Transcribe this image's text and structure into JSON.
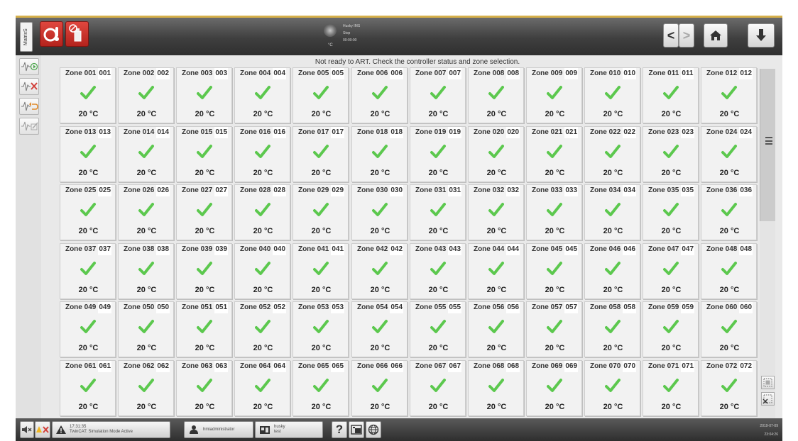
{
  "header": {
    "side_tab_label": "MatrixS",
    "media": {
      "unit": "°C",
      "line1": "Husky IMS",
      "line2": "Stop",
      "line3": "00:00:00"
    },
    "nav": {
      "back_label": "<",
      "forward_label": ">"
    }
  },
  "message": "Not ready to ART. Check the controller status and zone selection.",
  "zones": [
    {
      "name": "Zone 001",
      "num": "001",
      "temp": "20 °C",
      "status": "ok"
    },
    {
      "name": "Zone 002",
      "num": "002",
      "temp": "20 °C",
      "status": "ok"
    },
    {
      "name": "Zone 003",
      "num": "003",
      "temp": "20 °C",
      "status": "ok"
    },
    {
      "name": "Zone 004",
      "num": "004",
      "temp": "20 °C",
      "status": "ok"
    },
    {
      "name": "Zone 005",
      "num": "005",
      "temp": "20 °C",
      "status": "ok"
    },
    {
      "name": "Zone 006",
      "num": "006",
      "temp": "20 °C",
      "status": "ok"
    },
    {
      "name": "Zone 007",
      "num": "007",
      "temp": "20 °C",
      "status": "ok"
    },
    {
      "name": "Zone 008",
      "num": "008",
      "temp": "20 °C",
      "status": "ok"
    },
    {
      "name": "Zone 009",
      "num": "009",
      "temp": "20 °C",
      "status": "ok"
    },
    {
      "name": "Zone 010",
      "num": "010",
      "temp": "20 °C",
      "status": "ok"
    },
    {
      "name": "Zone 011",
      "num": "011",
      "temp": "20 °C",
      "status": "ok"
    },
    {
      "name": "Zone 012",
      "num": "012",
      "temp": "20 °C",
      "status": "ok"
    },
    {
      "name": "Zone 013",
      "num": "013",
      "temp": "20 °C",
      "status": "ok"
    },
    {
      "name": "Zone 014",
      "num": "014",
      "temp": "20 °C",
      "status": "ok"
    },
    {
      "name": "Zone 015",
      "num": "015",
      "temp": "20 °C",
      "status": "ok"
    },
    {
      "name": "Zone 016",
      "num": "016",
      "temp": "20 °C",
      "status": "ok"
    },
    {
      "name": "Zone 017",
      "num": "017",
      "temp": "20 °C",
      "status": "ok"
    },
    {
      "name": "Zone 018",
      "num": "018",
      "temp": "20 °C",
      "status": "ok"
    },
    {
      "name": "Zone 019",
      "num": "019",
      "temp": "20 °C",
      "status": "ok"
    },
    {
      "name": "Zone 020",
      "num": "020",
      "temp": "20 °C",
      "status": "ok"
    },
    {
      "name": "Zone 021",
      "num": "021",
      "temp": "20 °C",
      "status": "ok"
    },
    {
      "name": "Zone 022",
      "num": "022",
      "temp": "20 °C",
      "status": "ok"
    },
    {
      "name": "Zone 023",
      "num": "023",
      "temp": "20 °C",
      "status": "ok"
    },
    {
      "name": "Zone 024",
      "num": "024",
      "temp": "20 °C",
      "status": "ok"
    },
    {
      "name": "Zone 025",
      "num": "025",
      "temp": "20 °C",
      "status": "ok"
    },
    {
      "name": "Zone 026",
      "num": "026",
      "temp": "20 °C",
      "status": "ok"
    },
    {
      "name": "Zone 027",
      "num": "027",
      "temp": "20 °C",
      "status": "ok"
    },
    {
      "name": "Zone 028",
      "num": "028",
      "temp": "20 °C",
      "status": "ok"
    },
    {
      "name": "Zone 029",
      "num": "029",
      "temp": "20 °C",
      "status": "ok"
    },
    {
      "name": "Zone 030",
      "num": "030",
      "temp": "20 °C",
      "status": "ok"
    },
    {
      "name": "Zone 031",
      "num": "031",
      "temp": "20 °C",
      "status": "ok"
    },
    {
      "name": "Zone 032",
      "num": "032",
      "temp": "20 °C",
      "status": "ok"
    },
    {
      "name": "Zone 033",
      "num": "033",
      "temp": "20 °C",
      "status": "ok"
    },
    {
      "name": "Zone 034",
      "num": "034",
      "temp": "20 °C",
      "status": "ok"
    },
    {
      "name": "Zone 035",
      "num": "035",
      "temp": "20 °C",
      "status": "ok"
    },
    {
      "name": "Zone 036",
      "num": "036",
      "temp": "20 °C",
      "status": "ok"
    },
    {
      "name": "Zone 037",
      "num": "037",
      "temp": "20 °C",
      "status": "ok"
    },
    {
      "name": "Zone 038",
      "num": "038",
      "temp": "20 °C",
      "status": "ok"
    },
    {
      "name": "Zone 039",
      "num": "039",
      "temp": "20 °C",
      "status": "ok"
    },
    {
      "name": "Zone 040",
      "num": "040",
      "temp": "20 °C",
      "status": "ok"
    },
    {
      "name": "Zone 041",
      "num": "041",
      "temp": "20 °C",
      "status": "ok"
    },
    {
      "name": "Zone 042",
      "num": "042",
      "temp": "20 °C",
      "status": "ok"
    },
    {
      "name": "Zone 043",
      "num": "043",
      "temp": "20 °C",
      "status": "ok"
    },
    {
      "name": "Zone 044",
      "num": "044",
      "temp": "20 °C",
      "status": "ok"
    },
    {
      "name": "Zone 045",
      "num": "045",
      "temp": "20 °C",
      "status": "ok"
    },
    {
      "name": "Zone 046",
      "num": "046",
      "temp": "20 °C",
      "status": "ok"
    },
    {
      "name": "Zone 047",
      "num": "047",
      "temp": "20 °C",
      "status": "ok"
    },
    {
      "name": "Zone 048",
      "num": "048",
      "temp": "20 °C",
      "status": "ok"
    },
    {
      "name": "Zone 049",
      "num": "049",
      "temp": "20 °C",
      "status": "ok"
    },
    {
      "name": "Zone 050",
      "num": "050",
      "temp": "20 °C",
      "status": "ok"
    },
    {
      "name": "Zone 051",
      "num": "051",
      "temp": "20 °C",
      "status": "ok"
    },
    {
      "name": "Zone 052",
      "num": "052",
      "temp": "20 °C",
      "status": "ok"
    },
    {
      "name": "Zone 053",
      "num": "053",
      "temp": "20 °C",
      "status": "ok"
    },
    {
      "name": "Zone 054",
      "num": "054",
      "temp": "20 °C",
      "status": "ok"
    },
    {
      "name": "Zone 055",
      "num": "055",
      "temp": "20 °C",
      "status": "ok"
    },
    {
      "name": "Zone 056",
      "num": "056",
      "temp": "20 °C",
      "status": "ok"
    },
    {
      "name": "Zone 057",
      "num": "057",
      "temp": "20 °C",
      "status": "ok"
    },
    {
      "name": "Zone 058",
      "num": "058",
      "temp": "20 °C",
      "status": "ok"
    },
    {
      "name": "Zone 059",
      "num": "059",
      "temp": "20 °C",
      "status": "ok"
    },
    {
      "name": "Zone 060",
      "num": "060",
      "temp": "20 °C",
      "status": "ok"
    },
    {
      "name": "Zone 061",
      "num": "061",
      "temp": "20 °C",
      "status": "ok"
    },
    {
      "name": "Zone 062",
      "num": "062",
      "temp": "20 °C",
      "status": "ok"
    },
    {
      "name": "Zone 063",
      "num": "063",
      "temp": "20 °C",
      "status": "ok"
    },
    {
      "name": "Zone 064",
      "num": "064",
      "temp": "20 °C",
      "status": "ok"
    },
    {
      "name": "Zone 065",
      "num": "065",
      "temp": "20 °C",
      "status": "ok"
    },
    {
      "name": "Zone 066",
      "num": "066",
      "temp": "20 °C",
      "status": "ok"
    },
    {
      "name": "Zone 067",
      "num": "067",
      "temp": "20 °C",
      "status": "ok"
    },
    {
      "name": "Zone 068",
      "num": "068",
      "temp": "20 °C",
      "status": "ok"
    },
    {
      "name": "Zone 069",
      "num": "069",
      "temp": "20 °C",
      "status": "ok"
    },
    {
      "name": "Zone 070",
      "num": "070",
      "temp": "20 °C",
      "status": "ok"
    },
    {
      "name": "Zone 071",
      "num": "071",
      "temp": "20 °C",
      "status": "ok"
    },
    {
      "name": "Zone 072",
      "num": "072",
      "temp": "20 °C",
      "status": "ok"
    }
  ],
  "footer": {
    "event_time": "17:31:35",
    "event_text": "TwinCAT: Simulation Mode Active",
    "user": "hmiadministrator",
    "machine_line1": "husky",
    "machine_line2": "test",
    "help_label": "?",
    "date": "2019-07-09",
    "time": "23:04:26"
  },
  "colors": {
    "accent_gold": "#d6b04a",
    "alarm_red": "#c9302a",
    "check_green": "#5cc84e",
    "header_dark": "#3f3f3f"
  },
  "icons": [
    "alarm-thermometer-icon",
    "alarm-bottle-icon",
    "home-icon",
    "download-arrow-icon",
    "signal-play-icon",
    "signal-cancel-icon",
    "signal-undo-icon",
    "signal-edit-icon",
    "checkmark-icon",
    "menu-icon",
    "select-all-icon",
    "deselect-icon",
    "mute-icon",
    "alarm-reset-icon",
    "warning-icon",
    "user-icon",
    "machine-icon",
    "help-icon",
    "screenshot-icon",
    "globe-icon"
  ]
}
